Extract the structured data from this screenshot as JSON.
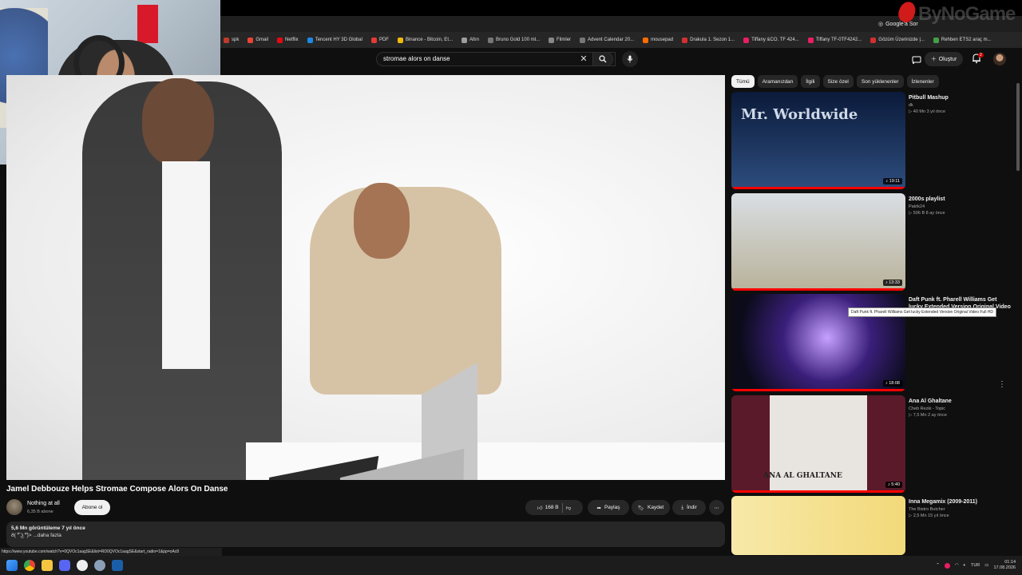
{
  "browser": {
    "google_sor": "Google'a Sor",
    "status_url": "https://www.youtube.com/watch?v=0QVOc1aagSE&list=RD0QVOc1aagSE&start_radio=1&pp=oAc8",
    "bookmarks": [
      {
        "label": "spk",
        "color": "#c0392b"
      },
      {
        "label": "Gmail",
        "color": "#ea4335"
      },
      {
        "label": "Netflix",
        "color": "#e50914"
      },
      {
        "label": "Tencent HY 3D Global",
        "color": "#1e88e5"
      },
      {
        "label": "PDF",
        "color": "#e53935"
      },
      {
        "label": "Binance - Bitcoin, Et...",
        "color": "#f0b90b"
      },
      {
        "label": "Altın",
        "color": "#9e9e9e"
      },
      {
        "label": "Bruno Gold 100 ml...",
        "color": "#777777"
      },
      {
        "label": "Filmler",
        "color": "#888888"
      },
      {
        "label": "Advent Calendar 20...",
        "color": "#777777"
      },
      {
        "label": "mousepad",
        "color": "#ff6d00"
      },
      {
        "label": "Drakula 1. Sezon 1...",
        "color": "#d32f2f"
      },
      {
        "label": "Tiffany &CO. TF 424...",
        "color": "#e91e63"
      },
      {
        "label": "Tiffany TF-0TF4242...",
        "color": "#e91e63"
      },
      {
        "label": "Gözüm Üzerinizde |...",
        "color": "#d32f2f"
      },
      {
        "label": "Rehben ETS2 araç m...",
        "color": "#43a047"
      }
    ]
  },
  "brand_logo": "ByNoGame",
  "header": {
    "search_value": "stromae alors on danse",
    "create_label": "Oluştur",
    "notification_count": "2"
  },
  "video": {
    "title": "Jamel Debbouze Helps Stromae Compose Alors On Danse",
    "channel": "Nothing at all",
    "subscribers": "6,35 B abone",
    "subscribe_label": "Abone ol",
    "likes": "168 B",
    "share_label": "Paylaş",
    "save_label": "Kaydet",
    "download_label": "İndir",
    "views_meta": "5,6 Mn görüntüleme  7 yıl önce",
    "description": "ð( ͡° ͜ʖ ͡°)> ...daha fazla"
  },
  "chips": [
    "Tümü",
    "Aramanızdan",
    "İlgili",
    "Size özel",
    "Son yüklenenler",
    "İzlenenler"
  ],
  "recommendations": [
    {
      "title": "Pitbull Mashup",
      "channel": "dk",
      "meta": "▷ 40 Mn  3 yıl önce",
      "duration": "♪ 19:11",
      "watched": 1.0,
      "thumb_bg": "linear-gradient(180deg,#0b1a3a,#2d4d7e)",
      "thumb_text": "Mr. Worldwide"
    },
    {
      "title": "2000s playlist",
      "channel": "Patrik24",
      "meta": "▷ 506 B  8 ay önce",
      "duration": "♪ 13:33",
      "watched": 1.0,
      "thumb_bg": "linear-gradient(180deg,#d9dee3,#b9b29a)",
      "thumb_text": ""
    },
    {
      "title": "Daft Punk ft. Pharell Williams Get lucky Extended Version Original Video Full HD",
      "channel": "",
      "meta": "▷ 26 Mn  12 yıl önce",
      "duration": "♪ 18:08",
      "watched": 1.0,
      "thumb_bg": "radial-gradient(circle at 55% 45%,#c6a0ff,#3a1f7a 40%,#0b0b1a 80%)",
      "thumb_text": ""
    },
    {
      "title": "Ana Al Ghaltane",
      "channel": "Cheb Rezki - Topic",
      "meta": "▷ 7,5 Mn  2 ay önce",
      "duration": "♪ 5:40",
      "watched": 1.0,
      "thumb_bg": "linear-gradient(90deg,#5a1a2a 0 22%,#e8e4e0 22% 78%,#5a1a2a 78%)",
      "thumb_text": "ANA AL GHALTANE"
    },
    {
      "title": "Inna Megamix (2009-2011)",
      "channel": "The Bistro Butcher",
      "meta": "▷ 2,5 Mn  15 yıl önce",
      "duration": "",
      "watched": 0,
      "thumb_bg": "linear-gradient(90deg,#f7e9a8,#f2d97a)",
      "thumb_text": ""
    }
  ],
  "tooltip": "Daft Punk ft. Pharell Williams Get lucky Extended Version Original Video Full HD",
  "taskbar": {
    "lang": "TUR",
    "time": "01:14",
    "date": "17.08.2026"
  }
}
